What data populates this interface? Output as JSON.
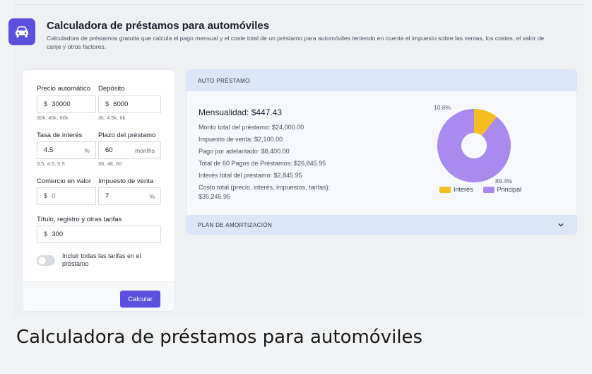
{
  "header": {
    "title": "Calculadora de préstamos para automóviles",
    "subtitle": "Calculadora de préstamos gratuita que calcula el pago mensual y el coste total de un préstamo para automóviles teniendo en cuenta el impuesto sobre las ventas, los costes, el valor de canje y otros factores.",
    "icon": "car-icon"
  },
  "form": {
    "price_label": "Precio automático",
    "price_prefix": "$",
    "price_value": "30000",
    "price_hint": "30k, 45k, 60k",
    "deposit_label": "Depósito",
    "deposit_prefix": "$",
    "deposit_value": "6000",
    "deposit_hint": "3k, 4.5k, 6k",
    "rate_label": "Tasa de interés",
    "rate_value": "4.5",
    "rate_suffix": "%",
    "rate_hint": "3.5, 4.5, 5.5",
    "term_label": "Plazo del préstamo",
    "term_value": "60",
    "term_suffix": "months",
    "term_hint": "36, 48, 60",
    "trade_label": "Comercio en valor",
    "trade_prefix": "$",
    "trade_value": "0",
    "tax_label": "Impuesto de venta",
    "tax_value": "7",
    "tax_suffix": "%",
    "fees_label": "Título, registro y otras tarifas",
    "fees_prefix": "$",
    "fees_value": "300",
    "include_fees_label": "Incluir todas las tarifas en el préstamo",
    "include_fees_on": false,
    "calculate_label": "Calcular"
  },
  "results": {
    "section_title": "AUTO PRÉSTAMO",
    "monthly": "Mensualidad: $447.43",
    "lines": [
      "Monto total del préstamo: $24,000.00",
      "Impuesto de venta: $2,100.00",
      "Pago por adelantado: $8,400.00",
      "Total de 60 Pagos de Préstamos: $26,845.95",
      "Interés total del préstamo: $2,845.95",
      "Costo total (precio, interés, impuestos, tarifas):",
      "$35,245.95"
    ],
    "amortization_title": "PLAN DE AMORTIZACIÓN"
  },
  "chart_data": {
    "type": "pie",
    "slices": [
      {
        "name": "Interés",
        "value": 10.6,
        "label": "10.6%",
        "color": "#f6bd20"
      },
      {
        "name": "Principal",
        "value": 89.4,
        "label": "89.4%",
        "color": "#a98bf0"
      }
    ],
    "donut": true,
    "legend": "bottom"
  },
  "colors": {
    "accent": "#5b4fe0",
    "interest": "#f6bd20",
    "principal": "#a98bf0"
  },
  "page_caption": "Calculadora de préstamos para automóviles"
}
